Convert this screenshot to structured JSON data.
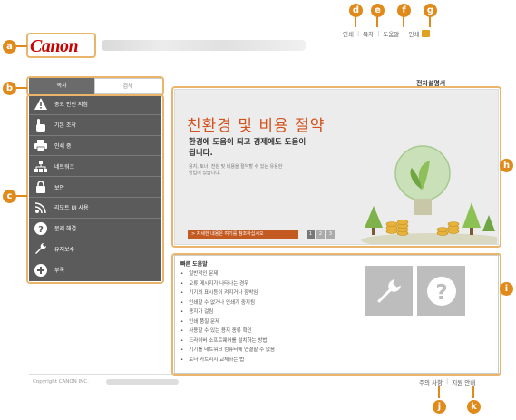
{
  "header": {
    "logo": "Canon",
    "links": [
      {
        "label": "인쇄",
        "callout": "d"
      },
      {
        "label": "목차",
        "callout": "e"
      },
      {
        "label": "도움말",
        "callout": "f"
      },
      {
        "label": "인쇄",
        "callout": "g"
      }
    ]
  },
  "tabs": [
    {
      "label": "목차"
    },
    {
      "label": "검색"
    }
  ],
  "sidebar": {
    "items": [
      {
        "label": "중요 안전 지침",
        "icon": "warning-icon"
      },
      {
        "label": "기본 조작",
        "icon": "hand-icon"
      },
      {
        "label": "인쇄 중",
        "icon": "printer-icon"
      },
      {
        "label": "네트워크",
        "icon": "network-icon"
      },
      {
        "label": "보안",
        "icon": "lock-icon"
      },
      {
        "label": "리모트 UI 사용",
        "icon": "remote-ui-icon"
      },
      {
        "label": "문제 해결",
        "icon": "question-icon"
      },
      {
        "label": "유지보수",
        "icon": "wrench-icon"
      },
      {
        "label": "부록",
        "icon": "plus-icon"
      }
    ]
  },
  "main": {
    "title": "전자설명서",
    "banner": {
      "title": "친환경 및 비용 절약",
      "sub_line1": "환경에 도움이 되고 경제에도 도움이",
      "sub_line2": "됩니다.",
      "body_line1": "용지, 토너, 전원 및 비용을 절약할 수 있는 유용한",
      "body_line2": "방법이 있습니다.",
      "button": "> 자세한 내용은 여기를 참조하십시오",
      "pages": [
        "1",
        "2",
        "3"
      ]
    },
    "quick_help": {
      "title": "빠른 도움말",
      "items": [
        "일반적인 문제",
        "오류 메시지가 나타나는 경우",
        "기기의 표시등이 켜지거나 깜박임",
        "인쇄할 수 없거나 인쇄가 중지됨",
        "용지가 걸림",
        "인쇄 품질 문제",
        "사용할 수 있는 용지 종류 확인",
        "드라이버 소프트웨어를 설치하는 방법",
        "기기를 네트워크 컴퓨터에 연결할 수 없음",
        "토너 카트리지 교체하는 법"
      ]
    }
  },
  "footer": {
    "copyright": "Copyright CANON INC.",
    "links": [
      {
        "label": "주의 사항",
        "callout": "j"
      },
      {
        "label": "지원 안내",
        "callout": "k"
      }
    ]
  },
  "callouts": {
    "a": "a",
    "b": "b",
    "c": "c",
    "d": "d",
    "e": "e",
    "f": "f",
    "g": "g",
    "h": "h",
    "i": "i",
    "j": "j",
    "k": "k"
  },
  "colors": {
    "callout": "#e08a1c",
    "sidebar": "#5b5b5b",
    "banner_title": "#d4501c",
    "logo": "#cc0000"
  }
}
